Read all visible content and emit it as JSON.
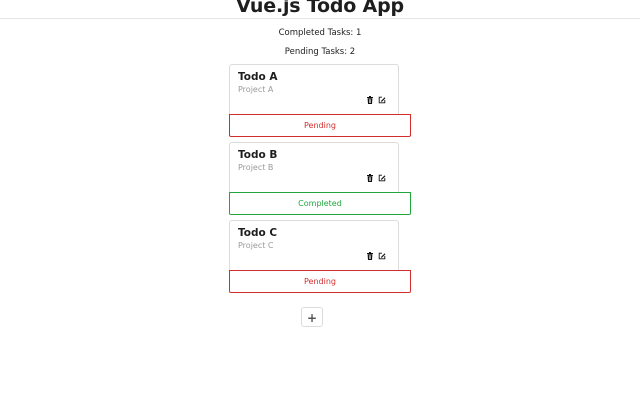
{
  "app": {
    "title": "Vue.js Todo App"
  },
  "stats": {
    "completed_label": "Completed Tasks: 1",
    "pending_label": "Pending Tasks: 2"
  },
  "todos": [
    {
      "title": "Todo A",
      "project": "Project A",
      "status": "Pending"
    },
    {
      "title": "Todo B",
      "project": "Project B",
      "status": "Completed"
    },
    {
      "title": "Todo C",
      "project": "Project C",
      "status": "Pending"
    }
  ],
  "icons": {
    "delete": "trash-icon",
    "edit": "edit-icon"
  },
  "colors": {
    "pending": "#d22d2d",
    "completed": "#21a63c"
  },
  "add_button": {
    "label": "+"
  }
}
